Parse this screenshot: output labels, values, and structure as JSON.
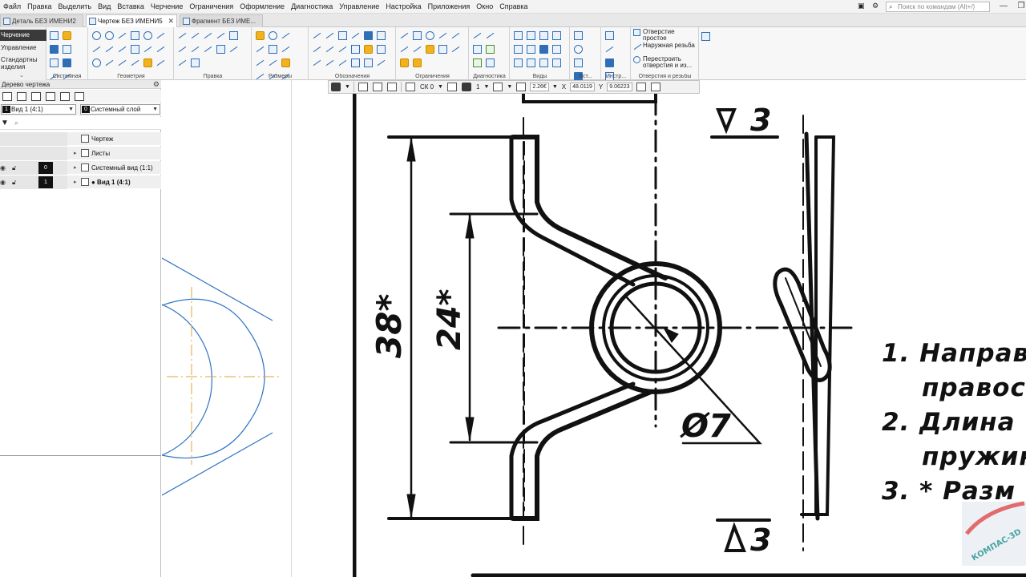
{
  "menu": [
    "Файл",
    "Правка",
    "Выделить",
    "Вид",
    "Вставка",
    "Черчение",
    "Ограничения",
    "Оформление",
    "Диагностика",
    "Управление",
    "Настройка",
    "Приложения",
    "Окно",
    "Справка"
  ],
  "search": {
    "placeholder": "Поиск по командам (Alt+/)"
  },
  "tabs": [
    {
      "label": "Деталь БЕЗ ИМЕНИ2",
      "active": false
    },
    {
      "label": "Чертеж БЕЗ ИМЕНИ5",
      "active": true,
      "close": "✕"
    },
    {
      "label": "Фрагмент БЕЗ ИМЕ...",
      "active": false
    }
  ],
  "modes": {
    "items": [
      "Черчение",
      "Управление",
      "Стандартные изделия"
    ],
    "active": "Черчение",
    "collapse": "⌄"
  },
  "ribbon": {
    "groups": [
      {
        "label": "Системная"
      },
      {
        "label": "Геометрия"
      },
      {
        "label": "Правка"
      },
      {
        "label": "Размеры"
      },
      {
        "label": "Обозначения"
      },
      {
        "label": "Ограничения"
      },
      {
        "label": "Диагностика"
      },
      {
        "label": "Виды"
      },
      {
        "label": "Вст..."
      },
      {
        "label": "Инстр..."
      },
      {
        "label": "Отверстия и резьбы"
      }
    ],
    "hole_commands": [
      "Отверстие простое",
      "Наружная резьба",
      "Перестроить отверстия и из..."
    ]
  },
  "tree": {
    "title": "Дерево чертежа",
    "view_combo": {
      "badge": "1",
      "value": "Вид 1 (4:1)"
    },
    "layer_combo": {
      "badge": "0",
      "value": "Системный слой"
    },
    "filter_placeholder": "",
    "nodes": [
      {
        "label": "Чертеж",
        "layer": ""
      },
      {
        "label": "Листы",
        "layer": ""
      },
      {
        "label": "Системный вид (1:1)",
        "layer": "0"
      },
      {
        "label": "● Вид 1 (4:1)",
        "layer": "1"
      }
    ]
  },
  "floating_toolbar": {
    "cs": "СК 0",
    "step": "1",
    "zoom": "2.26€",
    "x_label": "X",
    "x": "48.0119",
    "y_label": "Y",
    "y": "9.06223"
  },
  "drawing": {
    "dim_38": "38*",
    "dim_24": "24*",
    "dim_d7": "Ø7",
    "roughness_top": "3",
    "roughness_bottom": "3",
    "notes": [
      "1. Направ",
      "правос.",
      "2. Длина",
      "пружин",
      "3. * Разм"
    ]
  },
  "watermark": "КОМПАС-3D"
}
